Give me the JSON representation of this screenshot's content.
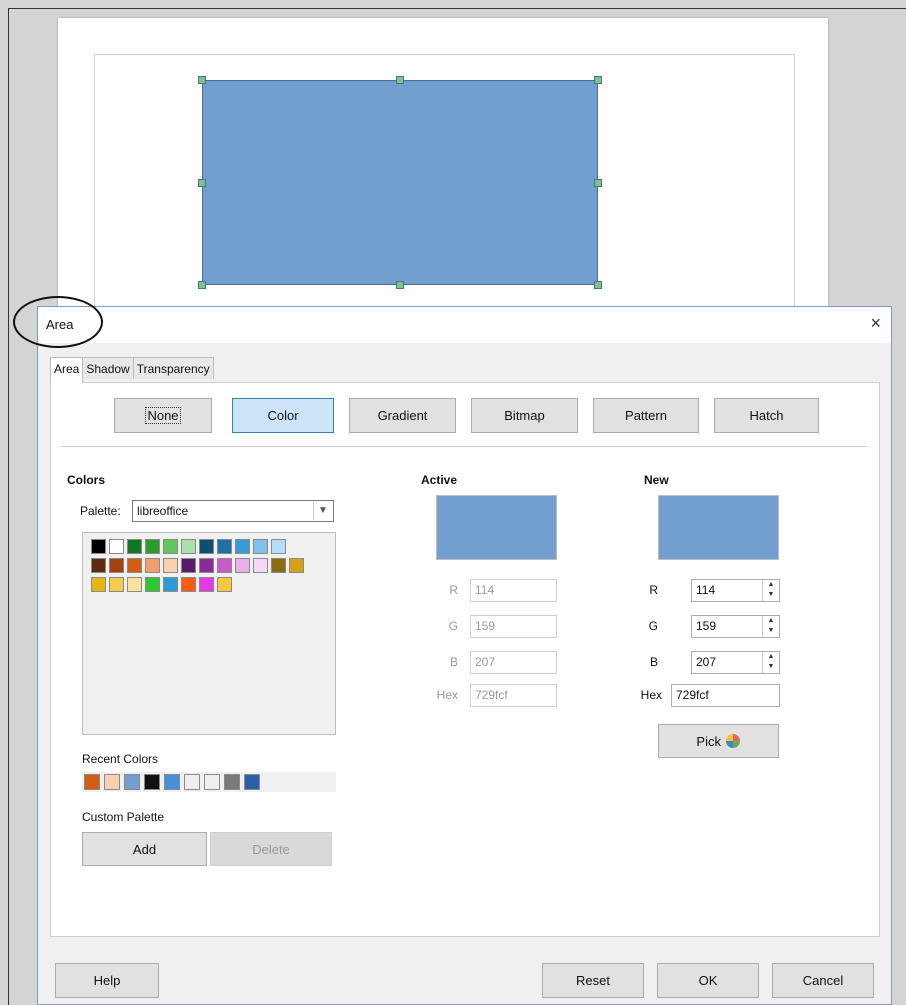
{
  "dialog": {
    "title": "Area",
    "close_glyph": "×",
    "tabs": [
      "Area",
      "Shadow",
      "Transparency"
    ],
    "fill_buttons": [
      "None",
      "Color",
      "Gradient",
      "Bitmap",
      "Pattern",
      "Hatch"
    ],
    "selected_fill": "Color"
  },
  "colors": {
    "heading": "Colors",
    "palette_label": "Palette:",
    "palette_value": "libreoffice",
    "swatches": [
      "#000000",
      "#ffffff",
      "#127622",
      "#2a9c2a",
      "#5ec75e",
      "#a7e3a7",
      "#0e4f6f",
      "#1e6fa3",
      "#3a9bd6",
      "#7fc1ec",
      "#b6dcf6",
      "#5c2a0f",
      "#a0430f",
      "#d45d12",
      "#f0a070",
      "#fbd0b0",
      "#5a1a6a",
      "#8b2a9a",
      "#c55cc9",
      "#e9b0ea",
      "#f6d7f6",
      "#8a6b10",
      "#d4a017",
      "#e3b814",
      "#f6cc50",
      "#fbe29a",
      "#30c830",
      "#2a9bd9",
      "#ff5a10",
      "#e23ae6",
      "#f6c840"
    ],
    "recent_label": "Recent Colors",
    "recent": [
      "#d45d12",
      "#fbd0b0",
      "#729fcf",
      "#111111",
      "#4a90d9",
      "#eeeeee",
      "#eeeeee",
      "#7a7a7a",
      "#2a5fa8"
    ],
    "custom_label": "Custom Palette",
    "add": "Add",
    "delete": "Delete"
  },
  "active": {
    "heading": "Active",
    "swatch": "#729fcf",
    "r_label": "R",
    "r": "114",
    "g_label": "G",
    "g": "159",
    "b_label": "B",
    "b": "207",
    "hex_label": "Hex",
    "hex": "729fcf"
  },
  "new": {
    "heading": "New",
    "swatch": "#729fcf",
    "r_label": "R",
    "r": "114",
    "g_label": "G",
    "g": "159",
    "b_label": "B",
    "b": "207",
    "hex_label": "Hex",
    "hex": "729fcf",
    "pick": "Pick"
  },
  "footer": {
    "help": "Help",
    "reset": "Reset",
    "ok": "OK",
    "cancel": "Cancel"
  }
}
